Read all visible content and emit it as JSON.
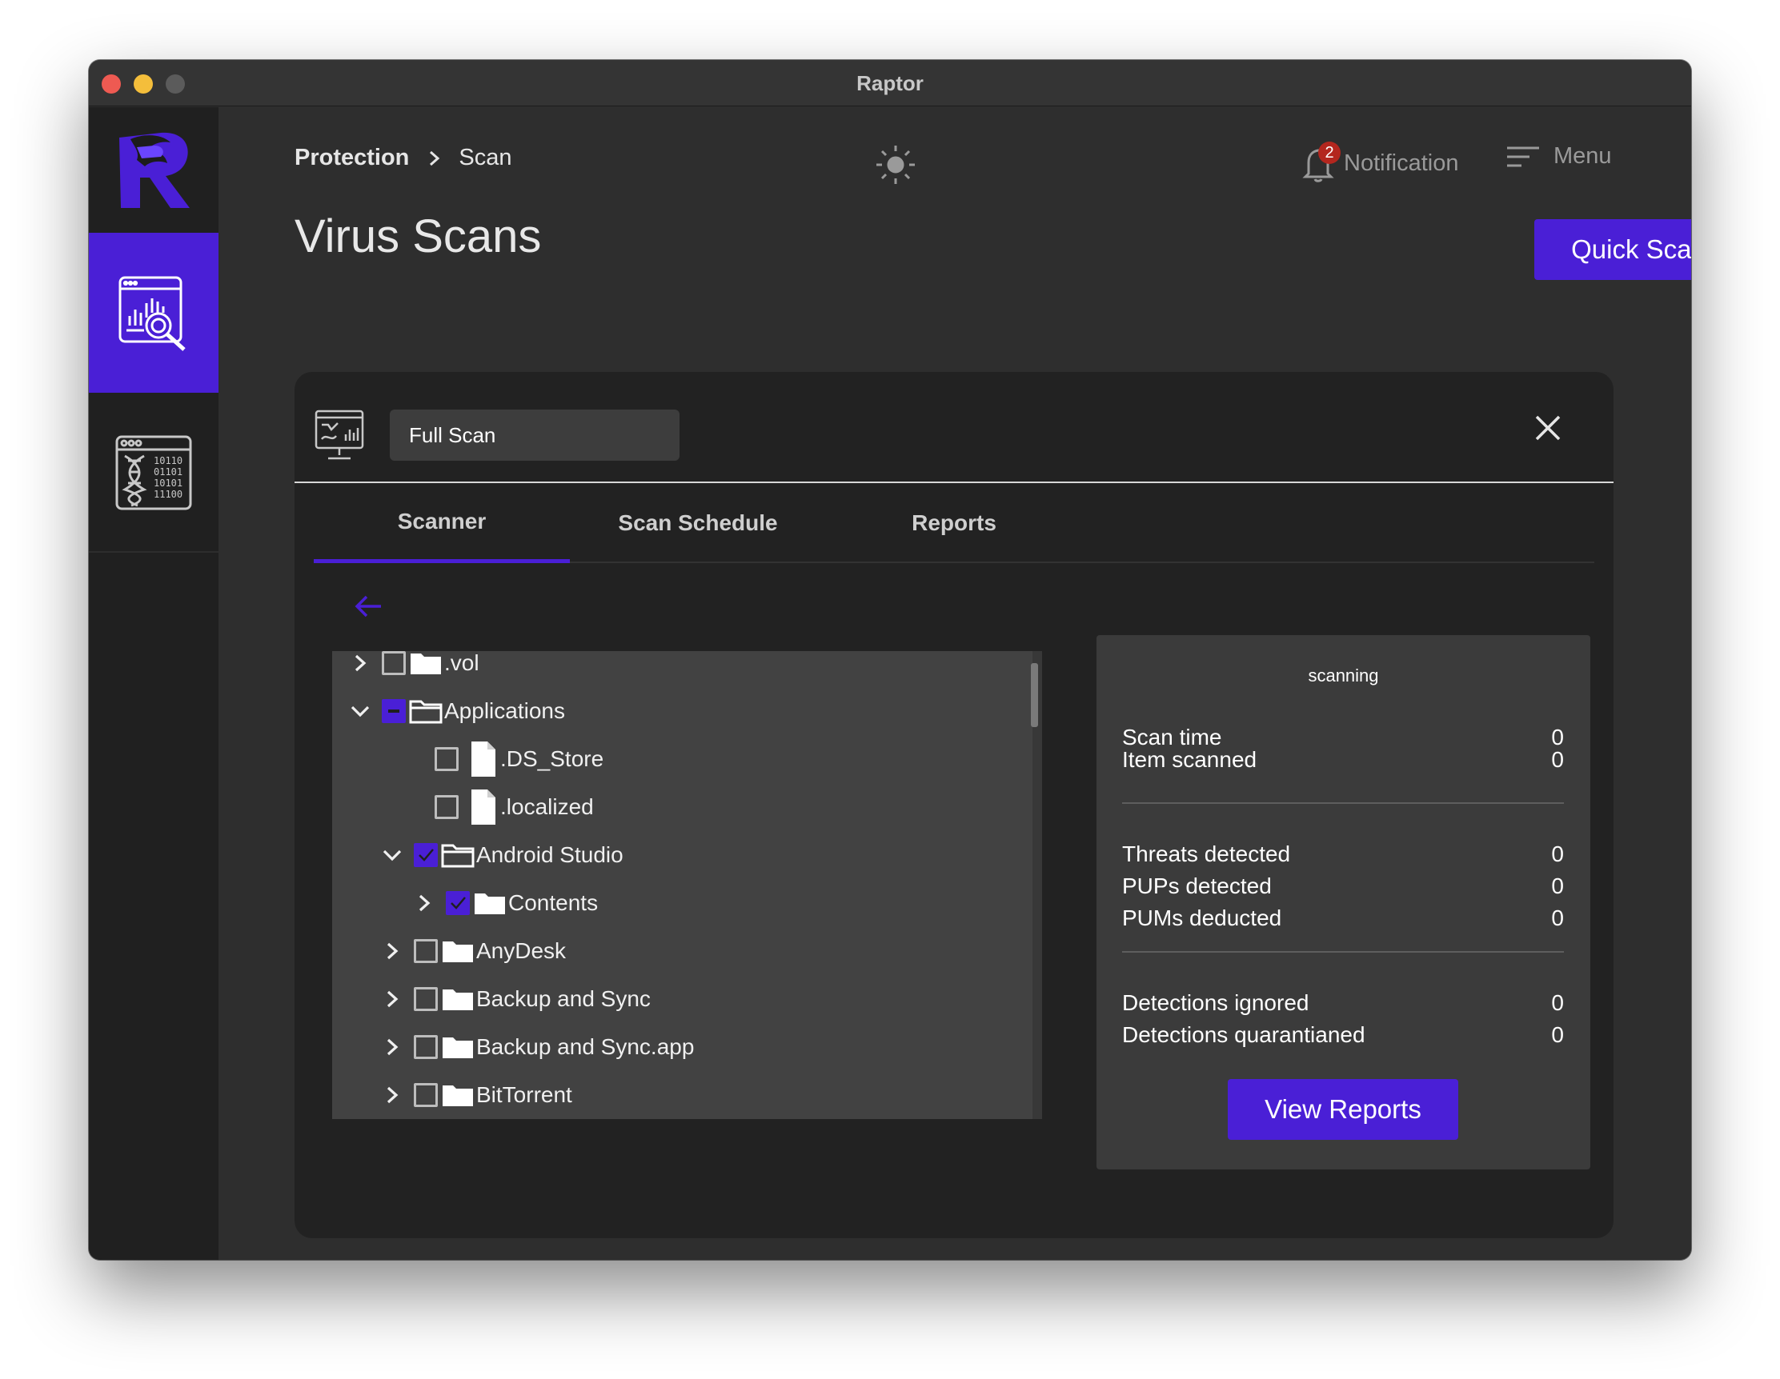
{
  "window": {
    "title": "Raptor"
  },
  "breadcrumb": {
    "parent": "Protection",
    "current": "Scan"
  },
  "header": {
    "notification_label": "Notification",
    "notification_count": "2",
    "menu_label": "Menu"
  },
  "page": {
    "title": "Virus Scans",
    "quick_scan_label": "Quick Scan"
  },
  "scan": {
    "name": "Full Scan",
    "tabs": [
      {
        "label": "Scanner",
        "active": true
      },
      {
        "label": "Scan Schedule",
        "active": false
      },
      {
        "label": "Reports",
        "active": false
      }
    ]
  },
  "tree": [
    {
      "label": ".vol",
      "depth": 0,
      "type": "folder",
      "expand": "collapsed",
      "check": "unchecked"
    },
    {
      "label": "Applications",
      "depth": 0,
      "type": "folder-open",
      "expand": "expanded",
      "check": "indeterminate"
    },
    {
      "label": ".DS_Store",
      "depth": 1,
      "type": "file",
      "expand": "none",
      "check": "unchecked"
    },
    {
      "label": ".localized",
      "depth": 1,
      "type": "file",
      "expand": "none",
      "check": "unchecked"
    },
    {
      "label": "Android Studio",
      "depth": 1,
      "type": "folder-open",
      "expand": "expanded",
      "check": "checked"
    },
    {
      "label": "Contents",
      "depth": 2,
      "type": "folder",
      "expand": "collapsed",
      "check": "checked"
    },
    {
      "label": "AnyDesk",
      "depth": 1,
      "type": "folder",
      "expand": "collapsed",
      "check": "unchecked"
    },
    {
      "label": "Backup and Sync",
      "depth": 1,
      "type": "folder",
      "expand": "collapsed",
      "check": "unchecked"
    },
    {
      "label": "Backup and Sync.app",
      "depth": 1,
      "type": "folder",
      "expand": "collapsed",
      "check": "unchecked"
    },
    {
      "label": "BitTorrent",
      "depth": 1,
      "type": "folder",
      "expand": "collapsed",
      "check": "unchecked"
    }
  ],
  "stats": {
    "status": "scanning",
    "groups": [
      [
        {
          "label": "Scan time",
          "value": "0"
        },
        {
          "label": "Item scanned",
          "value": "0"
        }
      ],
      [
        {
          "label": "Threats detected",
          "value": "0"
        },
        {
          "label": "PUPs detected",
          "value": "0"
        },
        {
          "label": "PUMs deducted",
          "value": "0"
        }
      ],
      [
        {
          "label": "Detections ignored",
          "value": "0"
        },
        {
          "label": "Detections quarantianed",
          "value": "0"
        }
      ]
    ],
    "view_reports_label": "View Reports"
  },
  "colors": {
    "accent": "#4a1fd6",
    "badge": "#b3261e",
    "window_bg": "#2e2e2e",
    "card_bg": "#222222"
  },
  "icons": [
    "raptor-logo-icon",
    "scan-report-icon",
    "dna-code-icon",
    "sun-icon",
    "bell-icon",
    "menu-lines-icon",
    "monitor-scan-icon",
    "close-icon",
    "arrow-left-icon",
    "chevron-right-icon",
    "chevron-down-icon",
    "folder-icon",
    "folder-open-icon",
    "file-icon"
  ]
}
